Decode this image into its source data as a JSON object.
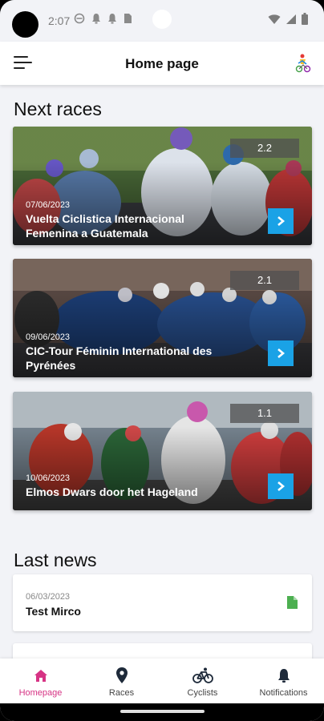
{
  "status_bar": {
    "time": "2:07",
    "icons": [
      "vpn-icon",
      "notification-bell-icon",
      "notification-bell-icon",
      "sim-card-icon"
    ],
    "right_icons": [
      "wifi-icon",
      "signal-icon",
      "battery-icon"
    ]
  },
  "app_bar": {
    "title": "Home page",
    "menu_icon": "hamburger-menu-icon",
    "logo_icon": "cycling-logo-icon"
  },
  "next_races": {
    "heading": "Next races",
    "items": [
      {
        "date": "07/06/2023",
        "name": "Vuelta Ciclistica Internacional Femenina a Guatemala",
        "class": "2.2"
      },
      {
        "date": "09/06/2023",
        "name": "CIC-Tour Féminin International des Pyrénées",
        "class": "2.1"
      },
      {
        "date": "10/06/2023",
        "name": "Elmos Dwars door het Hageland",
        "class": "1.1"
      }
    ]
  },
  "last_news": {
    "heading": "Last news",
    "items": [
      {
        "date": "06/03/2023",
        "title": "Test Mirco",
        "icon": "document-icon"
      },
      {
        "date": "",
        "title": "",
        "icon": ""
      }
    ]
  },
  "bottom_nav": {
    "items": [
      {
        "label": "Homepage",
        "icon": "home-icon",
        "active": true
      },
      {
        "label": "Races",
        "icon": "map-pin-icon",
        "active": false
      },
      {
        "label": "Cyclists",
        "icon": "bicycle-icon",
        "active": false
      },
      {
        "label": "Notifications",
        "icon": "bell-icon",
        "active": false
      }
    ]
  },
  "colors": {
    "accent": "#d63384",
    "action_button": "#1aa2e6",
    "news_icon": "#4caf50",
    "background": "#f2f3f7"
  }
}
